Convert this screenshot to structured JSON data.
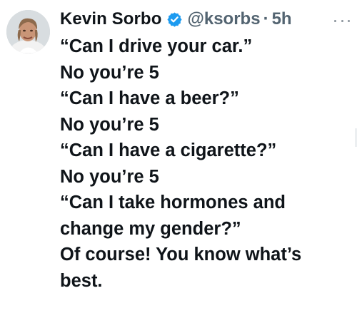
{
  "tweet": {
    "display_name": "Kevin Sorbo",
    "handle": "@ksorbs",
    "separator": "·",
    "time": "5h",
    "lines": [
      "“Can I drive your car.”",
      "No you’re 5",
      "“Can I have a beer?”",
      "No you’re 5",
      "“Can I have a cigarette?”",
      "No you’re 5",
      "“Can I take hormones and",
      "change my gender?”",
      "Of course! You know what’s",
      "best."
    ]
  },
  "icons": {
    "avatar": "profile-photo-icon",
    "verified": "verified-badge-icon",
    "more": "more-options-icon"
  },
  "colors": {
    "primary_text": "#0f1419",
    "secondary_text": "#536471",
    "verified_blue": "#1d9bf0",
    "background": "#ffffff"
  }
}
